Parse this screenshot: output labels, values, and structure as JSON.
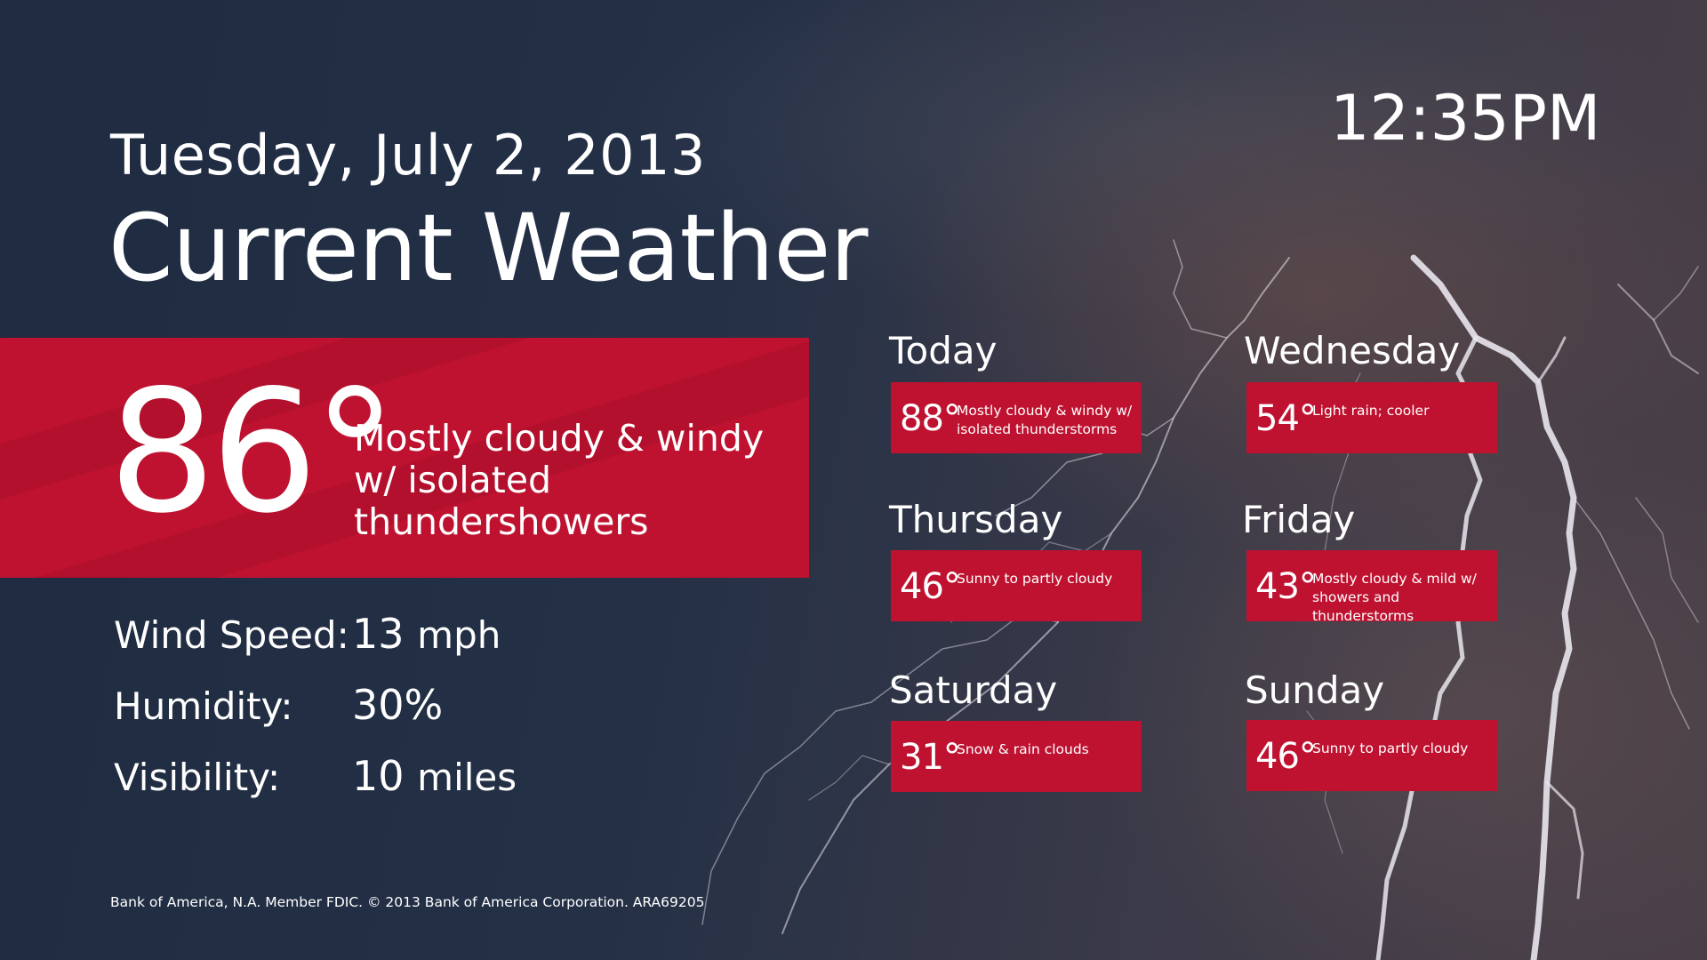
{
  "header": {
    "date": "Tuesday, July 2, 2013",
    "title": "Current Weather",
    "time": "12:35PM"
  },
  "current": {
    "temperature": "86°",
    "conditions": "Mostly cloudy & windy w/ isolated thundershowers"
  },
  "stats": {
    "wind_label": "Wind Speed:",
    "wind_value": "13",
    "wind_unit": "mph",
    "humidity_label": "Humidity:",
    "humidity_value": "30%",
    "visibility_label": "Visibility:",
    "visibility_value": "10",
    "visibility_unit": "miles"
  },
  "forecast": [
    {
      "day": "Today",
      "temp": "88°",
      "desc": "Mostly cloudy & windy w/ isolated thunderstorms"
    },
    {
      "day": "Wednesday",
      "temp": "54°",
      "desc": "Light rain; cooler"
    },
    {
      "day": "Thursday",
      "temp": "46°",
      "desc": "Sunny to partly cloudy"
    },
    {
      "day": "Friday",
      "temp": "43°",
      "desc": "Mostly cloudy & mild w/ showers and thunderstorms"
    },
    {
      "day": "Saturday",
      "temp": "31°",
      "desc": "Snow & rain clouds"
    },
    {
      "day": "Sunday",
      "temp": "46°",
      "desc": "Sunny to partly cloudy"
    }
  ],
  "footer": {
    "legal": "Bank of America, N.A. Member FDIC. © 2013 Bank of America Corporation. ARA69205"
  },
  "colors": {
    "accent_red": "#be1230",
    "background_dark": "#243046"
  }
}
